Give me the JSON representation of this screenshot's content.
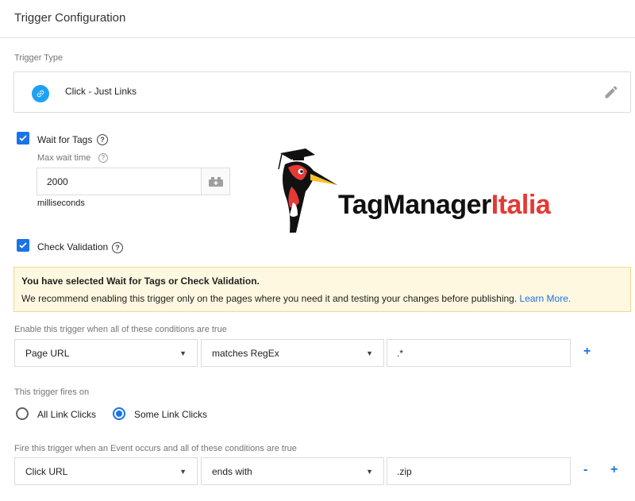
{
  "header": {
    "title": "Trigger Configuration"
  },
  "trigger_type": {
    "section_label": "Trigger Type",
    "label": "Click - Just Links",
    "icon": "link-icon",
    "icon_color": "#1da1f2"
  },
  "wait_for_tags": {
    "label": "Wait for Tags",
    "checked": true,
    "max_wait_label": "Max wait time",
    "max_wait_value": "2000",
    "unit": "milliseconds"
  },
  "check_validation": {
    "label": "Check Validation",
    "checked": true
  },
  "alert": {
    "title": "You have selected Wait for Tags or Check Validation.",
    "body": "We recommend enabling this trigger only on the pages where you need it and testing your changes before publishing.",
    "link": "Learn More."
  },
  "enable_conditions": {
    "label": "Enable this trigger when all of these conditions are true",
    "variable": "Page URL",
    "operator": "matches RegEx",
    "value": ".*",
    "add": "+"
  },
  "fires_on": {
    "label": "This trigger fires on",
    "options": [
      "All Link Clicks",
      "Some Link Clicks"
    ],
    "selected": "Some Link Clicks"
  },
  "fire_conditions": {
    "label": "Fire this trigger when an Event occurs and all of these conditions are true",
    "variable": "Click URL",
    "operator": "ends with",
    "value": ".zip",
    "remove": "-",
    "add": "+"
  },
  "logo": {
    "part1": "TagManager",
    "part2": "Italia",
    "color1": "#111111",
    "color2": "#e53935"
  },
  "colors": {
    "accent": "#1a73e8",
    "alert_bg": "#fef8e1"
  }
}
